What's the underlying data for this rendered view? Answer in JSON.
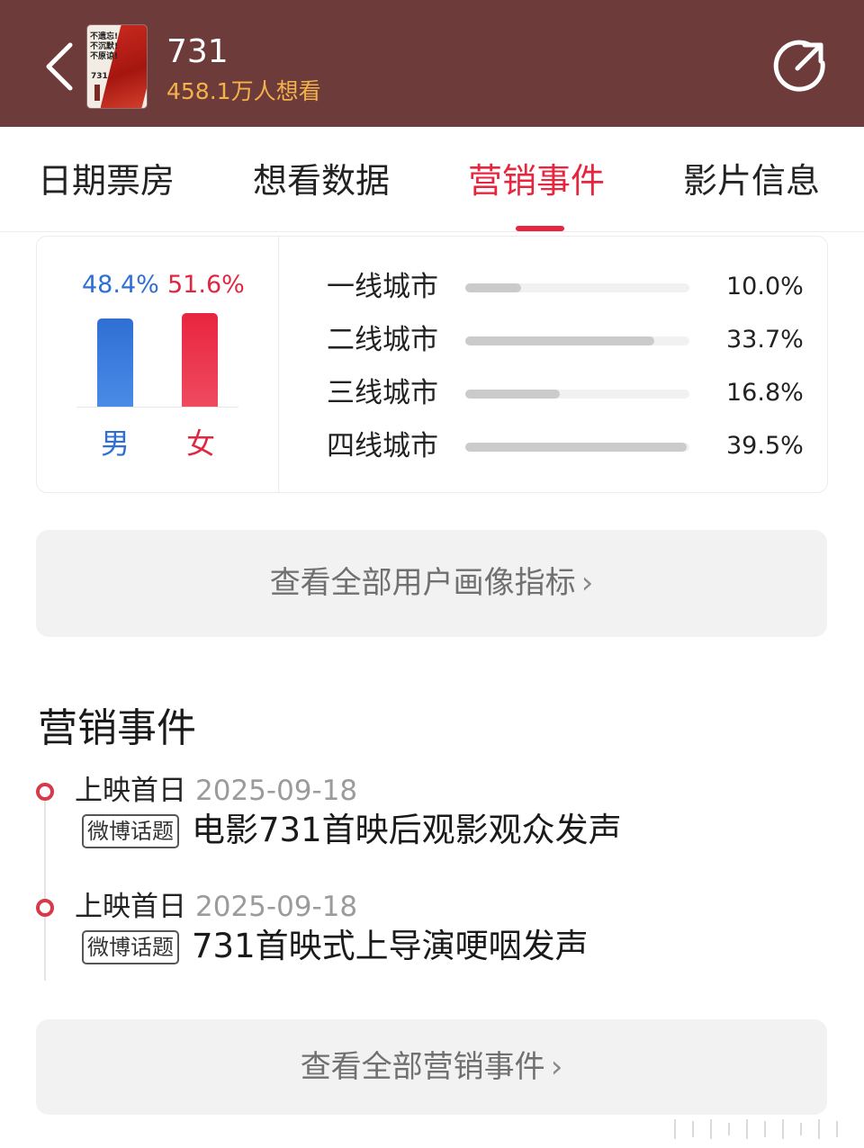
{
  "header": {
    "title": "731",
    "want_number": "458.1",
    "want_suffix": "万人想看",
    "poster_lines": [
      "不遗忘!",
      "不沉默!",
      "不原谅!"
    ],
    "poster_number": "731",
    "back_icon": "chevron-left-icon",
    "share_icon": "share-icon",
    "background": "#6e3b3b",
    "accent": "#f3b24a"
  },
  "tabs": [
    {
      "label": "日期票房",
      "active": false
    },
    {
      "label": "想看数据",
      "active": false
    },
    {
      "label": "营销事件",
      "active": true
    },
    {
      "label": "影片信息",
      "active": false
    }
  ],
  "gender": {
    "male": {
      "pct": "48.4%",
      "value": 48.4,
      "label": "男",
      "color": "#2f6fd4"
    },
    "female": {
      "pct": "51.6%",
      "value": 51.6,
      "label": "女",
      "color": "#e0273f"
    }
  },
  "cities": [
    {
      "name": "一线城市",
      "pct": "10.0%",
      "value": 10.0
    },
    {
      "name": "二线城市",
      "pct": "33.7%",
      "value": 33.7
    },
    {
      "name": "三线城市",
      "pct": "16.8%",
      "value": 16.8
    },
    {
      "name": "四线城市",
      "pct": "39.5%",
      "value": 39.5
    }
  ],
  "portrait_button": {
    "label": "查看全部用户画像指标",
    "chevron": "›"
  },
  "events_section": {
    "title": "营销事件",
    "items": [
      {
        "label": "上映首日",
        "date": "2025-09-18",
        "tag": "微博话题",
        "title": "电影731首映后观影观众发声"
      },
      {
        "label": "上映首日",
        "date": "2025-09-18",
        "tag": "微博话题",
        "title": "731首映式上导演哽咽发声"
      }
    ]
  },
  "events_button": {
    "label": "查看全部营销事件",
    "chevron": "›"
  },
  "colors": {
    "active_tab": "#e8253e",
    "timeline_dot": "#d63a4a"
  }
}
